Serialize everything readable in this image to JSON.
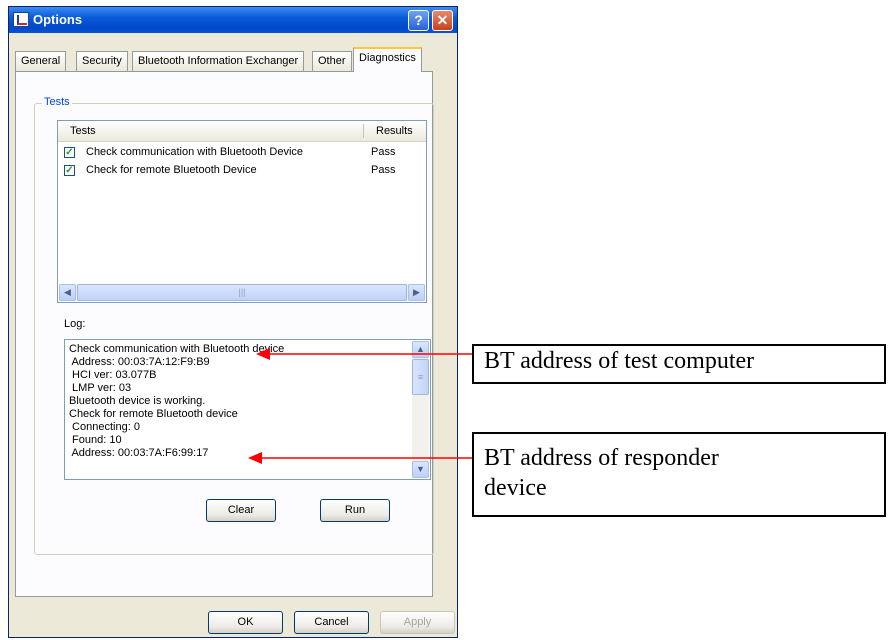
{
  "window": {
    "title": "Options",
    "help_symbol": "?",
    "close_symbol": "✕"
  },
  "tabs": [
    {
      "label": "General"
    },
    {
      "label": "Security"
    },
    {
      "label": "Bluetooth Information Exchanger"
    },
    {
      "label": "Other"
    },
    {
      "label": "Diagnostics",
      "active": true
    }
  ],
  "tests_group": {
    "legend": "Tests",
    "columns": [
      "Tests",
      "Results"
    ],
    "rows": [
      {
        "name": "Check communication with Bluetooth Device",
        "result": "Pass",
        "checked": true
      },
      {
        "name": "Check for remote Bluetooth Device",
        "result": "Pass",
        "checked": true
      }
    ],
    "log_label": "Log:",
    "log_lines": [
      "Check communication with Bluetooth device",
      " Address: 00:03:7A:12:F9:B9",
      " HCI ver: 03.077B",
      " LMP ver: 03",
      "Bluetooth device is working.",
      "Check for remote Bluetooth device",
      " Connecting: 0",
      " Found: 10",
      " Address: 00:03:7A:F6:99:17"
    ],
    "clear_button": "Clear",
    "run_button": "Run"
  },
  "dialog_buttons": {
    "ok": "OK",
    "cancel": "Cancel",
    "apply": "Apply"
  },
  "annotations": {
    "test_computer": "BT address of test computer",
    "responder_line1": "BT address of responder",
    "responder_line2": "device"
  },
  "colors": {
    "arrow": "#ff0000",
    "title_bar": "#0a5bd8",
    "accent": "#0046d5"
  }
}
